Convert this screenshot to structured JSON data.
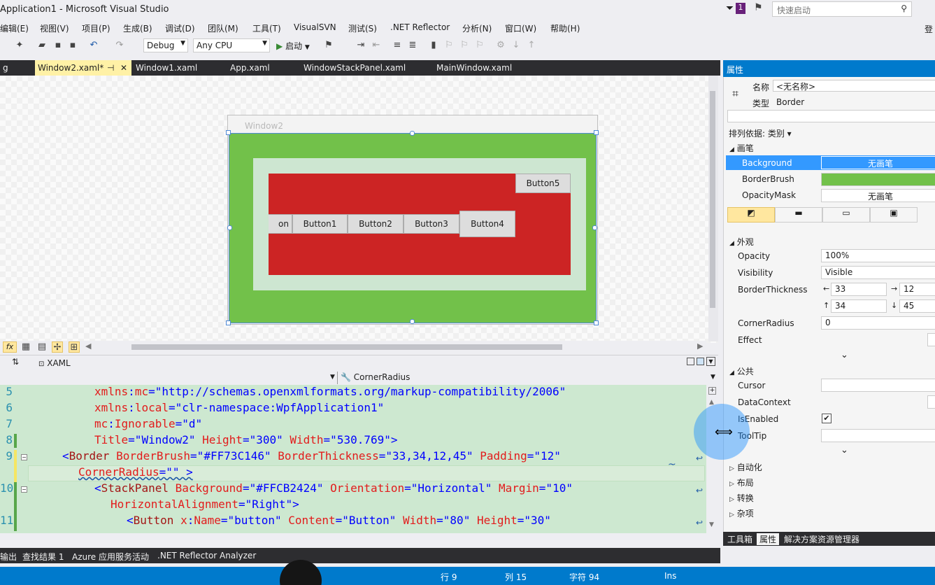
{
  "window": {
    "title": "Application1 - Microsoft Visual Studio"
  },
  "quick_launch": {
    "placeholder": "快速启动",
    "notification_count": "1"
  },
  "user": {
    "label": "登"
  },
  "menu": [
    "编辑(E)",
    "视图(V)",
    "项目(P)",
    "生成(B)",
    "调试(D)",
    "团队(M)",
    "工具(T)",
    "VisualSVN",
    "测试(S)",
    ".NET Reflector",
    "分析(N)",
    "窗口(W)",
    "帮助(H)"
  ],
  "toolbar": {
    "config": "Debug",
    "platform": "Any CPU",
    "start_label": "启动"
  },
  "tabs": [
    {
      "label": "g"
    },
    {
      "label": "Window2.xaml*",
      "active": true
    },
    {
      "label": "Window1.xaml"
    },
    {
      "label": "App.xaml"
    },
    {
      "label": "WindowStackPanel.xaml"
    },
    {
      "label": "MainWindow.xaml"
    }
  ],
  "designer": {
    "window_title": "Window2",
    "buttons": [
      "on",
      "Button1",
      "Button2",
      "Button3",
      "Button4",
      "Button5"
    ]
  },
  "split": {
    "xaml_tab": "XAML",
    "swap": "⇅"
  },
  "nav": {
    "property": "CornerRadius"
  },
  "code_lines": [
    {
      "num": "5",
      "parts": [
        {
          "t": "xmlns",
          "c": "k-at"
        },
        {
          "t": ":",
          "c": "k-v"
        },
        {
          "t": "mc",
          "c": "k-at"
        },
        {
          "t": "=\"http://schemas.openxmlformats.org/markup-compatibility/2006\"",
          "c": "k-v"
        }
      ]
    },
    {
      "num": "6",
      "parts": [
        {
          "t": "xmlns",
          "c": "k-at"
        },
        {
          "t": ":",
          "c": "k-v"
        },
        {
          "t": "local",
          "c": "k-at"
        },
        {
          "t": "=\"clr-namespace:WpfApplication1\"",
          "c": "k-v"
        }
      ]
    },
    {
      "num": "7",
      "parts": [
        {
          "t": "mc",
          "c": "k-at"
        },
        {
          "t": ":",
          "c": "k-v"
        },
        {
          "t": "Ignorable",
          "c": "k-at"
        },
        {
          "t": "=\"d\"",
          "c": "k-v"
        }
      ]
    },
    {
      "num": "8",
      "parts": [
        {
          "t": "Title",
          "c": "k-at"
        },
        {
          "t": "=\"Window2\" ",
          "c": "k-v"
        },
        {
          "t": "Height",
          "c": "k-at"
        },
        {
          "t": "=\"300\" ",
          "c": "k-v"
        },
        {
          "t": "Width",
          "c": "k-at"
        },
        {
          "t": "=\"530.769\">",
          "c": "k-v"
        }
      ]
    },
    {
      "num": "9",
      "parts": [
        {
          "t": "<",
          "c": "k-v"
        },
        {
          "t": "Border ",
          "c": "k-el"
        },
        {
          "t": "BorderBrush",
          "c": "k-at"
        },
        {
          "t": "=\"#FF73C146\" ",
          "c": "k-v"
        },
        {
          "t": "BorderThickness",
          "c": "k-at"
        },
        {
          "t": "=\"33,34,12,45\" ",
          "c": "k-v"
        },
        {
          "t": "Padding",
          "c": "k-at"
        },
        {
          "t": "=\"12\"",
          "c": "k-v"
        }
      ]
    },
    {
      "num": "",
      "parts": [
        {
          "t": "CornerRadius",
          "c": "k-at"
        },
        {
          "t": "=\"\" >",
          "c": "k-v"
        }
      ]
    },
    {
      "num": "10",
      "parts": [
        {
          "t": "<",
          "c": "k-v"
        },
        {
          "t": "StackPanel ",
          "c": "k-el"
        },
        {
          "t": "Background",
          "c": "k-at"
        },
        {
          "t": "=\"#FFCB2424\" ",
          "c": "k-v"
        },
        {
          "t": "Orientation",
          "c": "k-at"
        },
        {
          "t": "=\"Horizontal\" ",
          "c": "k-v"
        },
        {
          "t": "Margin",
          "c": "k-at"
        },
        {
          "t": "=\"10\"",
          "c": "k-v"
        }
      ]
    },
    {
      "num": "",
      "parts": [
        {
          "t": "HorizontalAlignment",
          "c": "k-at"
        },
        {
          "t": "=\"Right\">",
          "c": "k-v"
        }
      ]
    },
    {
      "num": "11",
      "parts": [
        {
          "t": "<",
          "c": "k-v"
        },
        {
          "t": "Button ",
          "c": "k-el"
        },
        {
          "t": "x",
          "c": "k-at"
        },
        {
          "t": ":",
          "c": "k-v"
        },
        {
          "t": "Name",
          "c": "k-at"
        },
        {
          "t": "=\"button\" ",
          "c": "k-v"
        },
        {
          "t": "Content",
          "c": "k-at"
        },
        {
          "t": "=\"Button\" ",
          "c": "k-v"
        },
        {
          "t": "Width",
          "c": "k-at"
        },
        {
          "t": "=\"80\" ",
          "c": "k-v"
        },
        {
          "t": "Height",
          "c": "k-at"
        },
        {
          "t": "=\"30\"",
          "c": "k-v"
        }
      ]
    }
  ],
  "bottom_tabs": [
    "输出",
    "查找结果 1",
    "Azure 应用服务活动",
    ".NET Reflector Analyzer"
  ],
  "status": {
    "row": "行 9",
    "col": "列 15",
    "char": "字符 94",
    "mode": "Ins"
  },
  "props": {
    "header": "属性",
    "name_label": "名称",
    "name_value": "<无名称>",
    "type_label": "类型",
    "type_value": "Border",
    "sort_label": "排列依据: 类别 ▾",
    "sect_brush": "画笔",
    "brush": [
      {
        "label": "Background",
        "value": "无画笔",
        "selected": true
      },
      {
        "label": "BorderBrush",
        "value": ""
      },
      {
        "label": "OpacityMask",
        "value": "无画笔"
      }
    ],
    "sect_appearance": "外观",
    "opacity_label": "Opacity",
    "opacity_value": "100%",
    "visibility_label": "Visibility",
    "visibility_value": "Visible",
    "bt_label": "BorderThickness",
    "bt_left": "33",
    "bt_right": "12",
    "bt_top": "34",
    "bt_bottom": "45",
    "cr_label": "CornerRadius",
    "cr_value": "0",
    "effect_label": "Effect",
    "sect_common": "公共",
    "cursor_label": "Cursor",
    "datacontext_label": "DataContext",
    "isenabled_label": "IsEnabled",
    "tooltip_label": "ToolTip",
    "sect_auto": "自动化",
    "sect_layout": "布局",
    "sect_transform": "转换",
    "sect_misc": "杂项",
    "bottom_tabs": [
      "工具箱",
      "属性",
      "解决方案资源管理器"
    ]
  },
  "colors": {
    "accent": "#007acc",
    "green": "#72c14a",
    "red": "#cc2424"
  }
}
